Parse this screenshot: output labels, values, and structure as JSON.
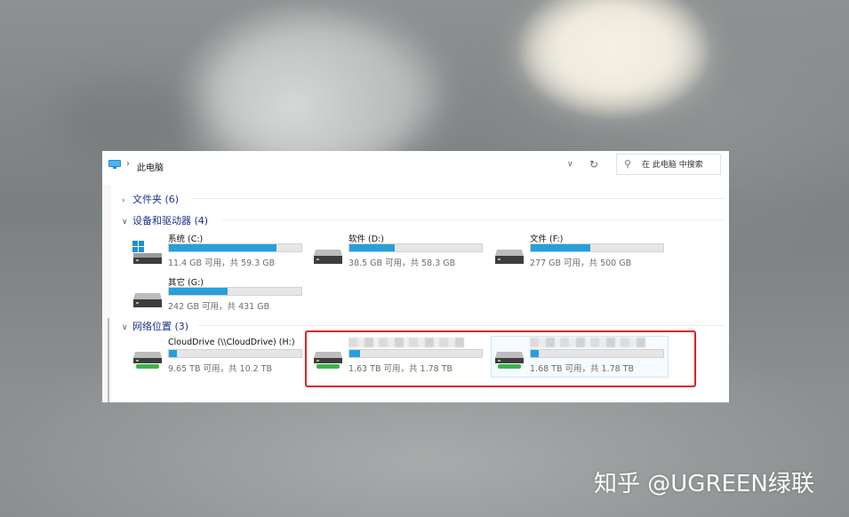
{
  "address": {
    "breadcrumb_sep": "›",
    "location": "此电脑",
    "dropdown_icon": "chevron-down",
    "refresh_icon": "refresh"
  },
  "search": {
    "placeholder": "在 此电脑 中搜索",
    "icon": "search"
  },
  "groups": {
    "folders": {
      "chevron": "›",
      "label": "文件夹 (6)"
    },
    "devices": {
      "chevron": "∨",
      "label": "设备和驱动器 (4)"
    },
    "network": {
      "chevron": "∨",
      "label": "网络位置 (3)"
    }
  },
  "drives": [
    {
      "name": "系统 (C:)",
      "info": "11.4 GB 可用，共 59.3 GB",
      "used_fraction": 0.81,
      "icon": "windows-drive-icon"
    },
    {
      "name": "软件 (D:)",
      "info": "38.5 GB 可用，共 58.3 GB",
      "used_fraction": 0.34,
      "icon": "hard-drive-icon"
    },
    {
      "name": "文件 (F:)",
      "info": "277 GB 可用，共 500 GB",
      "used_fraction": 0.45,
      "icon": "hard-drive-icon"
    },
    {
      "name": "其它 (G:)",
      "info": "242 GB 可用，共 431 GB",
      "used_fraction": 0.44,
      "icon": "hard-drive-icon"
    }
  ],
  "network_drives": [
    {
      "name": "CloudDrive (\\\\CloudDrive) (H:)",
      "info": "9.65 TB 可用，共 10.2 TB",
      "used_fraction": 0.06,
      "icon": "network-drive-icon"
    },
    {
      "name": "",
      "info": "1.63 TB 可用，共 1.78 TB",
      "used_fraction": 0.08,
      "icon": "network-drive-icon"
    },
    {
      "name": "",
      "info": "1.68 TB 可用，共 1.78 TB",
      "used_fraction": 0.06,
      "icon": "network-drive-icon"
    }
  ],
  "watermark": "知乎 @UGREEN绿联",
  "colors": {
    "bar_fill": "#26a0da",
    "group_header": "#1e3287",
    "highlight": "#e02020",
    "network_drive_accent": "#3cb44a"
  }
}
